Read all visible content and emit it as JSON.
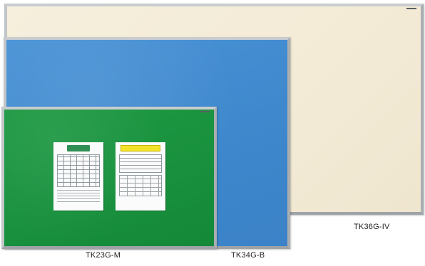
{
  "boards": [
    {
      "id": "ivory",
      "model": "TK36G-IV",
      "surface_color": "#f3ebd6"
    },
    {
      "id": "blue",
      "model": "TK34G-B",
      "surface_color": "#3f88cd"
    },
    {
      "id": "green",
      "model": "TK23G-M",
      "surface_color": "#18903d"
    }
  ],
  "frame_color": "#c2c6c9",
  "notices": [
    {
      "accent_color": "#2f8f55"
    },
    {
      "accent_color": "#f2e22a"
    }
  ]
}
